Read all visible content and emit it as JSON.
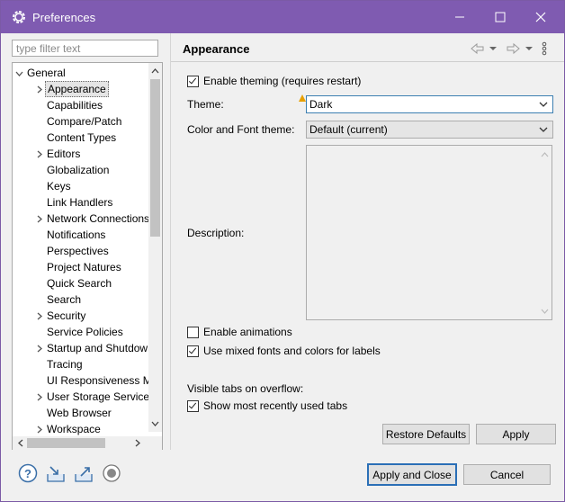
{
  "window": {
    "title": "Preferences",
    "icon": "gear-icon"
  },
  "titlebar": {
    "minimize_icon": "minimize-icon",
    "maximize_icon": "maximize-icon",
    "close_icon": "close-icon"
  },
  "filter": {
    "placeholder": "type filter text"
  },
  "tree": {
    "root": "General",
    "items": [
      {
        "label": "Appearance",
        "expandable": true,
        "selected": true
      },
      {
        "label": "Capabilities",
        "expandable": false
      },
      {
        "label": "Compare/Patch",
        "expandable": false
      },
      {
        "label": "Content Types",
        "expandable": false
      },
      {
        "label": "Editors",
        "expandable": true
      },
      {
        "label": "Globalization",
        "expandable": false
      },
      {
        "label": "Keys",
        "expandable": false
      },
      {
        "label": "Link Handlers",
        "expandable": false
      },
      {
        "label": "Network Connections",
        "expandable": true
      },
      {
        "label": "Notifications",
        "expandable": false
      },
      {
        "label": "Perspectives",
        "expandable": false
      },
      {
        "label": "Project Natures",
        "expandable": false
      },
      {
        "label": "Quick Search",
        "expandable": false
      },
      {
        "label": "Search",
        "expandable": false
      },
      {
        "label": "Security",
        "expandable": true
      },
      {
        "label": "Service Policies",
        "expandable": false
      },
      {
        "label": "Startup and Shutdown",
        "expandable": true
      },
      {
        "label": "Tracing",
        "expandable": false
      },
      {
        "label": "UI Responsiveness Monitoring",
        "expandable": false
      },
      {
        "label": "User Storage Service",
        "expandable": true
      },
      {
        "label": "Web Browser",
        "expandable": false
      },
      {
        "label": "Workspace",
        "expandable": true
      }
    ]
  },
  "page": {
    "title": "Appearance",
    "enable_theming": {
      "label": "Enable theming (requires restart)",
      "checked": true
    },
    "theme": {
      "label": "Theme:",
      "value": "Dark"
    },
    "color_font_theme": {
      "label": "Color and Font theme:",
      "value": "Default (current)"
    },
    "description": {
      "label": "Description:",
      "value": ""
    },
    "enable_animations": {
      "label": "Enable animations",
      "checked": false
    },
    "mixed_fonts": {
      "label": "Use mixed fonts and colors for labels",
      "checked": true
    },
    "visible_tabs_label": "Visible tabs on overflow:",
    "show_mru_tabs": {
      "label": "Show most recently used tabs",
      "checked": true
    },
    "restore_defaults": "Restore Defaults",
    "apply": "Apply"
  },
  "footer": {
    "apply_and_close": "Apply and Close",
    "cancel": "Cancel",
    "icons": [
      "help-icon",
      "import-icon",
      "export-icon",
      "record-icon"
    ]
  },
  "colors": {
    "titlebar": "#7f5bb1",
    "focus": "#2b6fb6"
  }
}
